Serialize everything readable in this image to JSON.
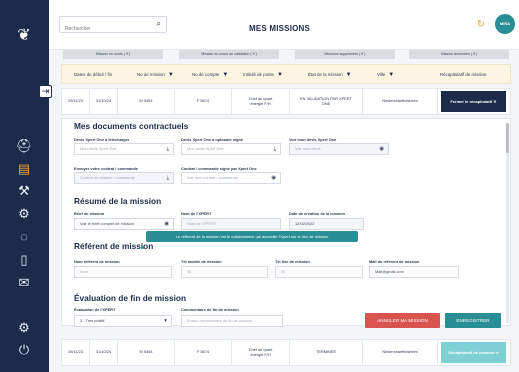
{
  "header": {
    "title": "MES MISSIONS",
    "search_placeholder": "Rechercher",
    "avatar_initials": "MIRA"
  },
  "sidebar": {
    "icons": [
      "logo-icon",
      "collapse-icon",
      "helmet-icon",
      "briefcase-icon",
      "tools-icon",
      "settings-icon",
      "chat-icon",
      "document-icon",
      "mail-icon",
      "gear-icon",
      "power-icon"
    ]
  },
  "status_tabs": [
    "Mission en cours ( 9 )",
    "Mission en cours de validation ( 9 )",
    "Missions supprimées ( 9 )",
    "Mission terminées ( 9 )"
  ],
  "filters": [
    "Dates de début / fin",
    "No de mission",
    "No de compte",
    "Intitulé de poste",
    "État de la mission",
    "Ville",
    "Récapitulatif de mission"
  ],
  "row1": {
    "start": "29/11/23",
    "end": "31/10/24",
    "mission_no": "M 5454",
    "account_no": "F 5874",
    "job_title": "Chef de quart énergie F/H",
    "state": "EN VALIDATION PAR XPERT ONE",
    "city": "Niedershaeffolsheim",
    "action": "Fermer le récapitulatif ✕"
  },
  "row2": {
    "start": "29/11/23",
    "end": "31/10/24",
    "mission_no": "M 5454",
    "account_no": "F 5874",
    "job_title": "Chef de quart énergie F/H",
    "state": "TERMINÉE",
    "city": "Niedershaeffolsheim",
    "action": "Récapitulatif de mission ⇒"
  },
  "documents": {
    "title": "Mes documents contractuels",
    "label_download": "Devis Xpert One à télécharger",
    "ph_download": "Mon devis Xpert One",
    "label_upload": "Devis Xpert One à uploader signé",
    "ph_upload": "Mon devis Xpert One",
    "label_signed": "Voir mon devis Xpert One",
    "ph_signed": "Voir mon devis",
    "label_contract": "Envoyer votre contrat / commande",
    "ph_contract": "Contrat de mission / commande",
    "label_contract_signed": "Contrat / commande signé par Xpert One",
    "ph_contract_signed": "Voir mon contrat / commande"
  },
  "summary": {
    "title": "Résumé de la mission",
    "label_brief": "Brief de mission",
    "value_brief": "Voir le brief complet de mission",
    "label_xpert": "Nom de l'XPERT",
    "ph_xpert": "Nom de l'XPERT",
    "label_date": "Date de création de la mission",
    "value_date": "12/02/2022"
  },
  "referent": {
    "title": "Référent de mission",
    "tooltip": "Le référent de la mission est le collaborateur qui accueille l'Xpert sur le lieu de mission",
    "label_name": "Nom référent de mission",
    "ph_name": "Nom",
    "label_mobile": "Tél mobile de mission",
    "ph_mobile": "06",
    "label_fixed": "Tél fixe de mission",
    "ph_fixed": "06",
    "label_mail": "Mail du référent de mission",
    "value_mail": "Mail@gmail.com"
  },
  "evaluation": {
    "title": "Évaluation de fin de mission",
    "label_eval": "Évaluation de l'XPERT",
    "value_eval": "3 - Très positif",
    "label_comment": "Commentaire de fin de mission",
    "ph_comment": "Entrez commentaire de fin de mission",
    "cancel_label": "ANNULER MA MISSION",
    "save_label": "ENREGISTRER"
  },
  "colors": {
    "navy": "#1c2b4a",
    "teal": "#2a8f94",
    "orange": "#f0a830",
    "red": "#d9534f"
  }
}
